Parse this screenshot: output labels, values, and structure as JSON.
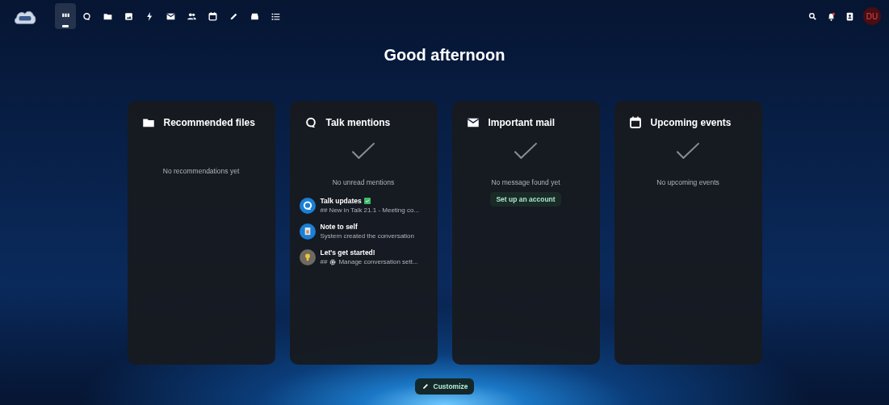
{
  "header": {
    "apps": [
      {
        "kind": "dashboard",
        "selected": true
      },
      {
        "kind": "talk",
        "selected": false
      },
      {
        "kind": "files",
        "selected": false
      },
      {
        "kind": "photos",
        "selected": false
      },
      {
        "kind": "activity",
        "selected": false
      },
      {
        "kind": "mail",
        "selected": false
      },
      {
        "kind": "contacts",
        "selected": false
      },
      {
        "kind": "calendar",
        "selected": false
      },
      {
        "kind": "notes",
        "selected": false
      },
      {
        "kind": "deck",
        "selected": false
      },
      {
        "kind": "tasks",
        "selected": false
      }
    ],
    "avatar": "DU"
  },
  "greeting": "Good afternoon",
  "widgets": [
    {
      "kind": "files",
      "title": "Recommended files",
      "empty_check": false,
      "empty_text": "No recommendations yet"
    },
    {
      "kind": "talk",
      "title": "Talk mentions",
      "empty_check": true,
      "empty_text": "No unread mentions",
      "items": [
        {
          "kind": "talk",
          "title": "Talk updates",
          "verified": true,
          "subtitle": "## New in Talk 21.1 - Meeting co..."
        },
        {
          "kind": "note",
          "title": "Note to self",
          "verified": false,
          "subtitle": "System created the conversation"
        },
        {
          "kind": "bulb",
          "title": "Let's get started!",
          "verified": false,
          "subtitle_prefix": "##",
          "subtitle_gear": true,
          "subtitle": "Manage conversation sett..."
        }
      ]
    },
    {
      "kind": "mail",
      "title": "Important mail",
      "empty_check": true,
      "empty_text": "No message found yet",
      "button": "Set up an account"
    },
    {
      "kind": "calendar",
      "title": "Upcoming events",
      "empty_check": true,
      "empty_text": "No upcoming events"
    }
  ],
  "customize": "Customize"
}
